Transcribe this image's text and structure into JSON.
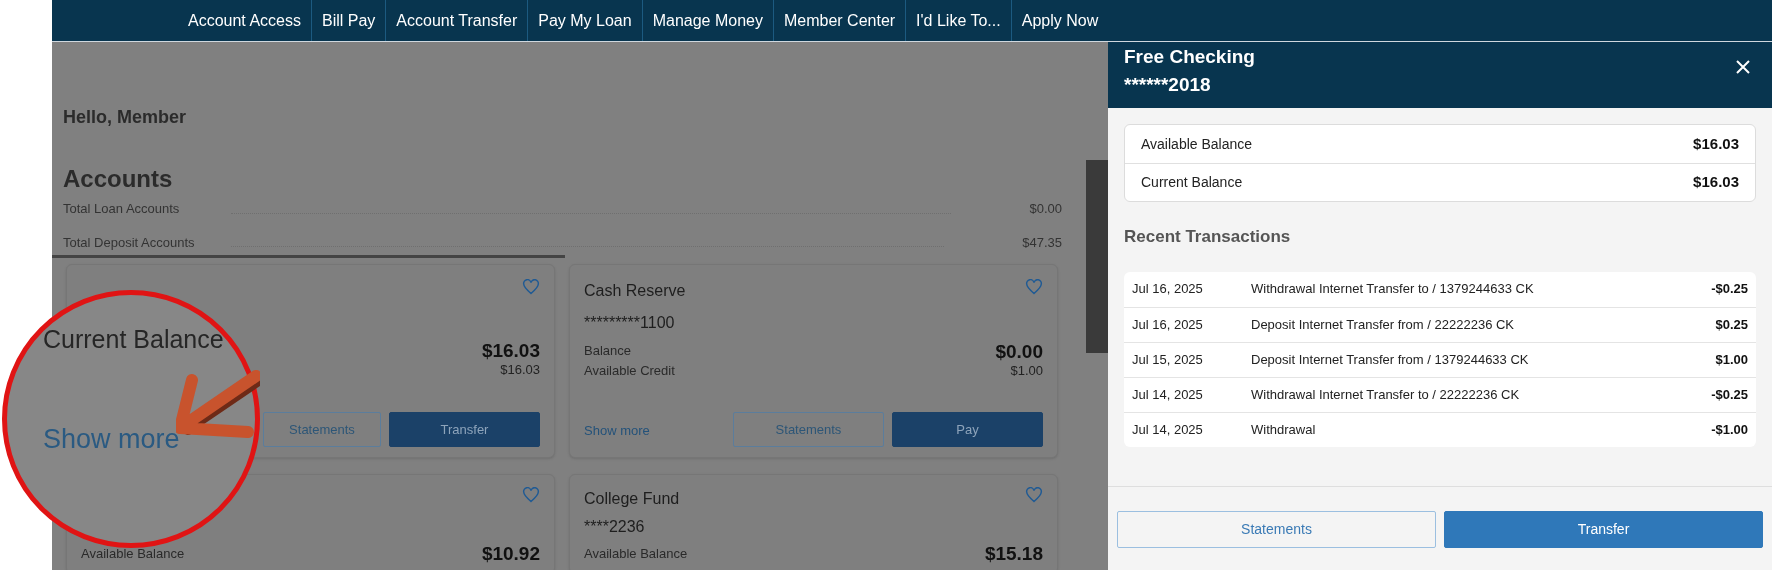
{
  "nav": [
    "Account Access",
    "Bill Pay",
    "Account Transfer",
    "Pay My Loan",
    "Manage Money",
    "Member Center",
    "I'd Like To...",
    "Apply Now"
  ],
  "greeting": "Hello, Member",
  "accounts_title": "Accounts",
  "totals": [
    {
      "label": "Total Loan Accounts",
      "value": "$0.00"
    },
    {
      "label": "Total Deposit Accounts",
      "value": "$47.35"
    }
  ],
  "cards": [
    {
      "rows": [
        {
          "label": "",
          "value": "$16.03",
          "strong": true
        },
        {
          "label": "",
          "value": "$16.03",
          "strong": false
        }
      ],
      "buttons": [
        {
          "label": "Statements",
          "kind": "outline"
        },
        {
          "label": "Transfer",
          "kind": "primary"
        }
      ]
    },
    {
      "title": "Cash Reserve",
      "number": "*********1100",
      "rows": [
        {
          "label": "Balance",
          "value": "$0.00",
          "strong": true
        },
        {
          "label": "Available Credit",
          "value": "$1.00",
          "strong": false
        }
      ],
      "show_more": "Show more",
      "buttons": [
        {
          "label": "Statements",
          "kind": "outline"
        },
        {
          "label": "Pay",
          "kind": "primary"
        }
      ]
    },
    {
      "rows": [
        {
          "label": "Available Balance",
          "value": "$10.92",
          "strong": true
        }
      ]
    },
    {
      "title": "College Fund",
      "number": "****2236",
      "rows": [
        {
          "label": "Available Balance",
          "value": "$15.18",
          "strong": true
        }
      ]
    }
  ],
  "magnifier": {
    "label": "Current Balance",
    "link": "Show more"
  },
  "panel": {
    "title": "Free Checking",
    "account_number": "******2018",
    "balances": [
      {
        "label": "Available Balance",
        "value": "$16.03"
      },
      {
        "label": "Current Balance",
        "value": "$16.03"
      }
    ],
    "section_title": "Recent Transactions",
    "transactions": [
      {
        "date": "Jul 16, 2025",
        "description": "Withdrawal Internet Transfer to / 1379244633 CK",
        "amount": "-$0.25"
      },
      {
        "date": "Jul 16, 2025",
        "description": "Deposit Internet Transfer from / 22222236 CK",
        "amount": "$0.25"
      },
      {
        "date": "Jul 15, 2025",
        "description": "Deposit Internet Transfer from / 1379244633 CK",
        "amount": "$1.00"
      },
      {
        "date": "Jul 14, 2025",
        "description": "Withdrawal Internet Transfer to / 22222236 CK",
        "amount": "-$0.25"
      },
      {
        "date": "Jul 14, 2025",
        "description": "Withdrawal",
        "amount": "-$1.00"
      }
    ],
    "buttons": [
      {
        "label": "Statements",
        "kind": "outline"
      },
      {
        "label": "Transfer",
        "kind": "primary"
      }
    ]
  }
}
